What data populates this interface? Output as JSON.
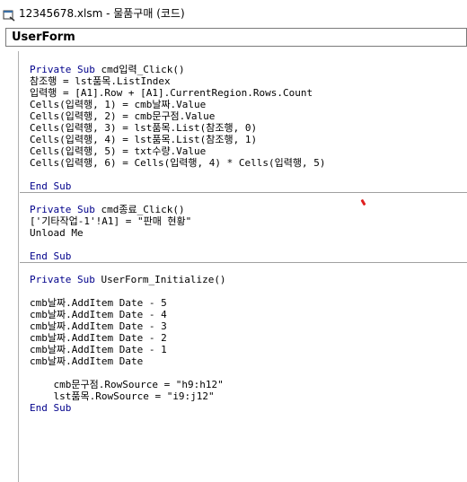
{
  "window": {
    "title": "12345678.xlsm - 물품구매 (코드)"
  },
  "object_selector": {
    "value": "UserForm"
  },
  "code": {
    "keywords": {
      "private": "Private",
      "sub": "Sub",
      "end_sub": "End Sub"
    },
    "proc1": {
      "name": "cmd입력_Click()",
      "lines": [
        "참조행 = lst품목.ListIndex",
        "입력행 = [A1].Row + [A1].CurrentRegion.Rows.Count",
        "Cells(입력행, 1) = cmb날짜.Value",
        "Cells(입력행, 2) = cmb문구점.Value",
        "Cells(입력행, 3) = lst품목.List(참조행, 0)",
        "Cells(입력행, 4) = lst품목.List(참조행, 1)",
        "Cells(입력행, 5) = txt수량.Value",
        "Cells(입력행, 6) = Cells(입력행, 4) * Cells(입력행, 5)"
      ]
    },
    "proc2": {
      "name": "cmd종료_Click()",
      "lines": [
        "['기타작업-1'!A1] = \"판매 현황\"",
        "Unload Me"
      ]
    },
    "proc3": {
      "name": "UserForm_Initialize()",
      "lines": [
        "cmb날짜.AddItem Date - 5",
        "cmb날짜.AddItem Date - 4",
        "cmb날짜.AddItem Date - 3",
        "cmb날짜.AddItem Date - 2",
        "cmb날짜.AddItem Date - 1",
        "cmb날짜.AddItem Date",
        "    cmb문구점.RowSource = \"h9:h12\"",
        "    lst품목.RowSource = \"i9:j12\""
      ]
    }
  }
}
